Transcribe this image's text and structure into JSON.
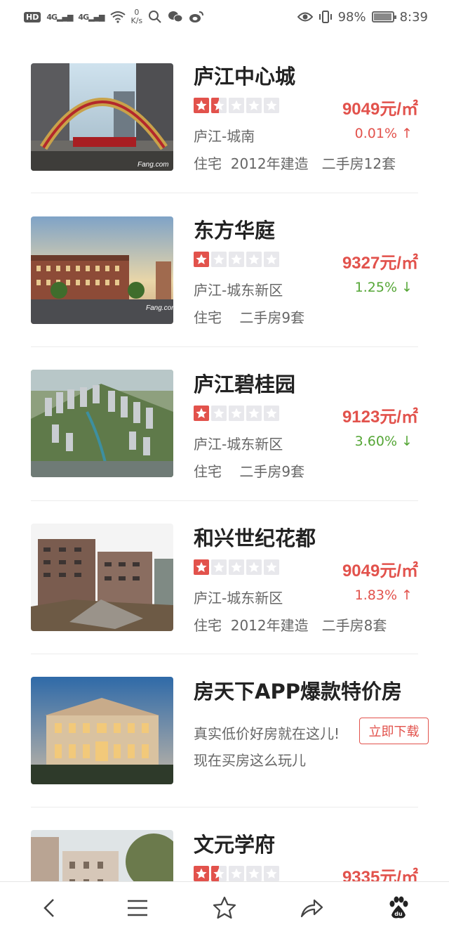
{
  "status_bar": {
    "hd": "HD",
    "net1": "4G",
    "net2": "4G",
    "speed_value": "0",
    "speed_unit": "K/s",
    "battery": "98%",
    "time": "8:39"
  },
  "listings": [
    {
      "title": "庐江中心城",
      "stars": 1.5,
      "price": "9049元/㎡",
      "district": "庐江-城南",
      "change": "0.01% ↑",
      "trend": "up",
      "meta": "住宅  2012年建造   二手房12套"
    },
    {
      "title": "东方华庭",
      "stars": 1,
      "price": "9327元/㎡",
      "district": "庐江-城东新区",
      "change": "1.25% ↓",
      "trend": "down",
      "meta": "住宅    二手房9套"
    },
    {
      "title": "庐江碧桂园",
      "stars": 1,
      "price": "9123元/㎡",
      "district": "庐江-城东新区",
      "change": "3.60% ↓",
      "trend": "down",
      "meta": "住宅    二手房9套"
    },
    {
      "title": "和兴世纪花都",
      "stars": 1,
      "price": "9049元/㎡",
      "district": "庐江-城东新区",
      "change": "1.83% ↑",
      "trend": "up",
      "meta": "住宅  2012年建造   二手房8套"
    }
  ],
  "ad": {
    "title": "房天下APP爆款特价房",
    "line1": "真实低价好房就在这儿!",
    "line2": "现在买房这么玩儿",
    "button": "立即下载"
  },
  "partial_listing": {
    "title": "文元学府",
    "stars": 1.5,
    "price": "9335元/㎡"
  },
  "photo_watermark": "Fang.com",
  "bottom_nav": [
    "back-icon",
    "menu-icon",
    "star-icon",
    "share-icon",
    "baidu-paw-icon"
  ],
  "baidu_label": "du",
  "colors": {
    "accent_red": "#e2524c",
    "down_green": "#55a636",
    "star_empty": "#e8e8ec"
  }
}
